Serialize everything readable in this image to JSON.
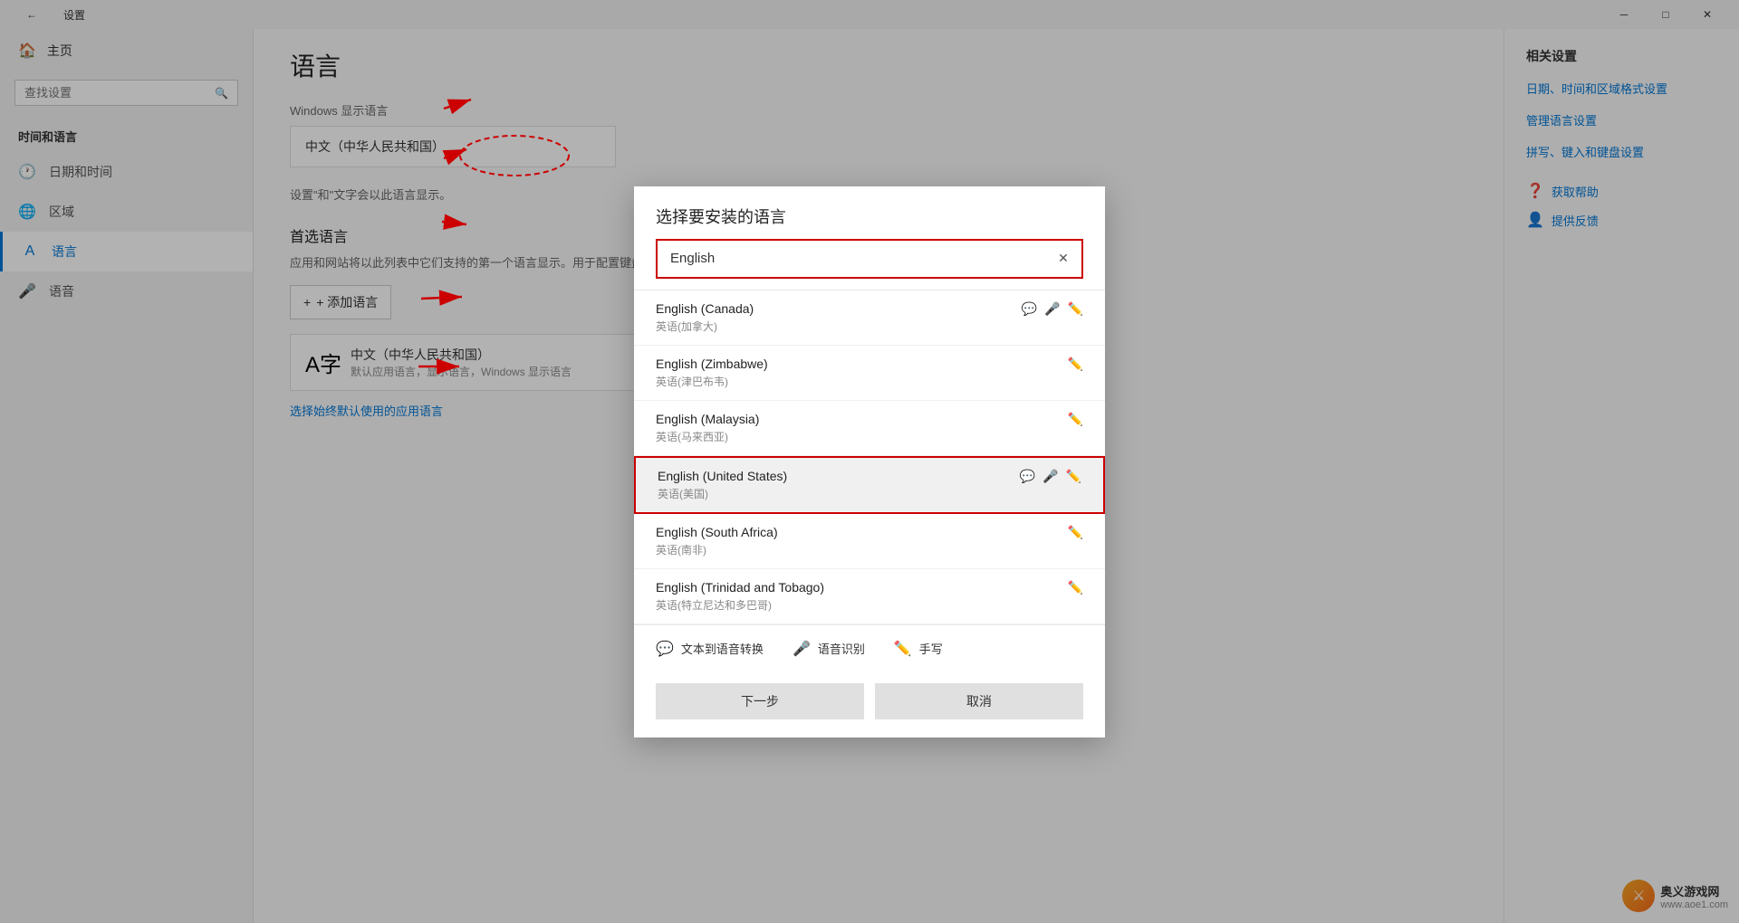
{
  "window": {
    "title": "设置",
    "back_label": "←",
    "min_label": "─",
    "max_label": "□",
    "close_label": "✕"
  },
  "sidebar": {
    "home_label": "主页",
    "search_placeholder": "查找设置",
    "section_label": "时间和语言",
    "items": [
      {
        "id": "date-time",
        "icon": "🕐",
        "label": "日期和时间"
      },
      {
        "id": "region",
        "icon": "🌐",
        "label": "区域"
      },
      {
        "id": "language",
        "icon": "A",
        "label": "语言",
        "active": true
      },
      {
        "id": "speech",
        "icon": "🎤",
        "label": "语音"
      }
    ]
  },
  "main": {
    "page_title": "语言",
    "windows_display_label": "Windows 显示语言",
    "windows_display_value": "中文（中华人民共和国）",
    "windows_display_note": "设置\"和\"文字会以此语言显示。",
    "preferred_section_title": "首选语言",
    "preferred_desc": "应用和网站将以此列表中它们支持的第一个语言显示。用于配置键盘和其他功能。",
    "add_lang_label": "+ 添加语言",
    "lang_entry_name": "中文（中华人民共和国）",
    "lang_entry_desc": "默认应用语言，显示语言，Windows 显示语言",
    "default_link": "选择始终默认使用的应用语言"
  },
  "related": {
    "title": "相关设置",
    "links": [
      {
        "label": "日期、时间和区域格式设置"
      },
      {
        "label": "管理语言设置"
      },
      {
        "label": "拼写、键入和键盘设置"
      }
    ],
    "help_items": [
      {
        "icon": "?",
        "label": "获取帮助"
      },
      {
        "icon": "👤",
        "label": "提供反馈"
      }
    ]
  },
  "dialog": {
    "title": "选择要安装的语言",
    "search_value": "English",
    "search_placeholder": "",
    "clear_label": "✕",
    "languages": [
      {
        "id": "en-CA",
        "name": "English (Canada)",
        "sub": "英语(加拿大)",
        "icons": [
          "speech",
          "mic",
          "pen"
        ],
        "selected": false
      },
      {
        "id": "en-ZW",
        "name": "English (Zimbabwe)",
        "sub": "英语(津巴布韦)",
        "icons": [
          "pen"
        ],
        "selected": false
      },
      {
        "id": "en-MY",
        "name": "English (Malaysia)",
        "sub": "英语(马来西亚)",
        "icons": [
          "pen"
        ],
        "selected": false
      },
      {
        "id": "en-US",
        "name": "English (United States)",
        "sub": "英语(美国)",
        "icons": [
          "speech",
          "mic",
          "pen"
        ],
        "selected": true
      },
      {
        "id": "en-ZA",
        "name": "English (South Africa)",
        "sub": "英语(南非)",
        "icons": [
          "pen"
        ],
        "selected": false
      },
      {
        "id": "en-TT",
        "name": "English (Trinidad and Tobago)",
        "sub": "英语(特立尼达和多巴哥)",
        "icons": [
          "pen"
        ],
        "selected": false
      }
    ],
    "legend": [
      {
        "icon": "💬",
        "label": "文本到语音转换"
      },
      {
        "icon": "🎤",
        "label": "语音识别"
      },
      {
        "icon": "✏️",
        "label": "手写"
      }
    ],
    "btn_next": "下一步",
    "btn_cancel": "取消"
  },
  "watermark": {
    "text": "奥义游戏网",
    "sub": "www.aoe1.com"
  }
}
